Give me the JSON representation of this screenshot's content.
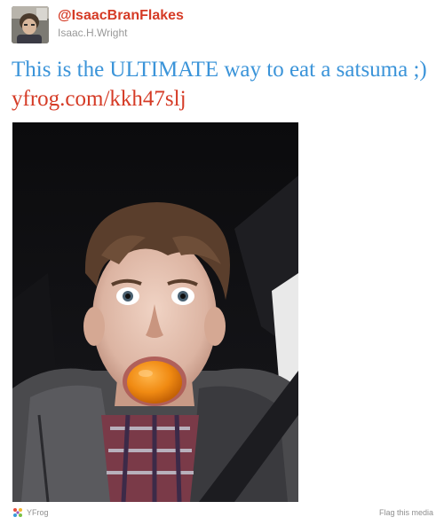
{
  "header": {
    "handle": "@IsaacBranFlakes",
    "full_name": "Isaac.H.Wright",
    "avatar_icon": "user-avatar"
  },
  "tweet": {
    "text": "This is the ULTIMATE way to eat a satsuma ;)",
    "link": "yfrog.com/kkh47slj"
  },
  "media": {
    "description_icon": "photo",
    "provider_name": "YFrog",
    "provider_icon": "yfrog-logo-icon",
    "flag_label": "Flag this media"
  },
  "colors": {
    "handle": "#d53b26",
    "tweet_text": "#3b94d9",
    "link": "#d53b26",
    "meta": "#999999",
    "footer": "#8f8f8f"
  }
}
